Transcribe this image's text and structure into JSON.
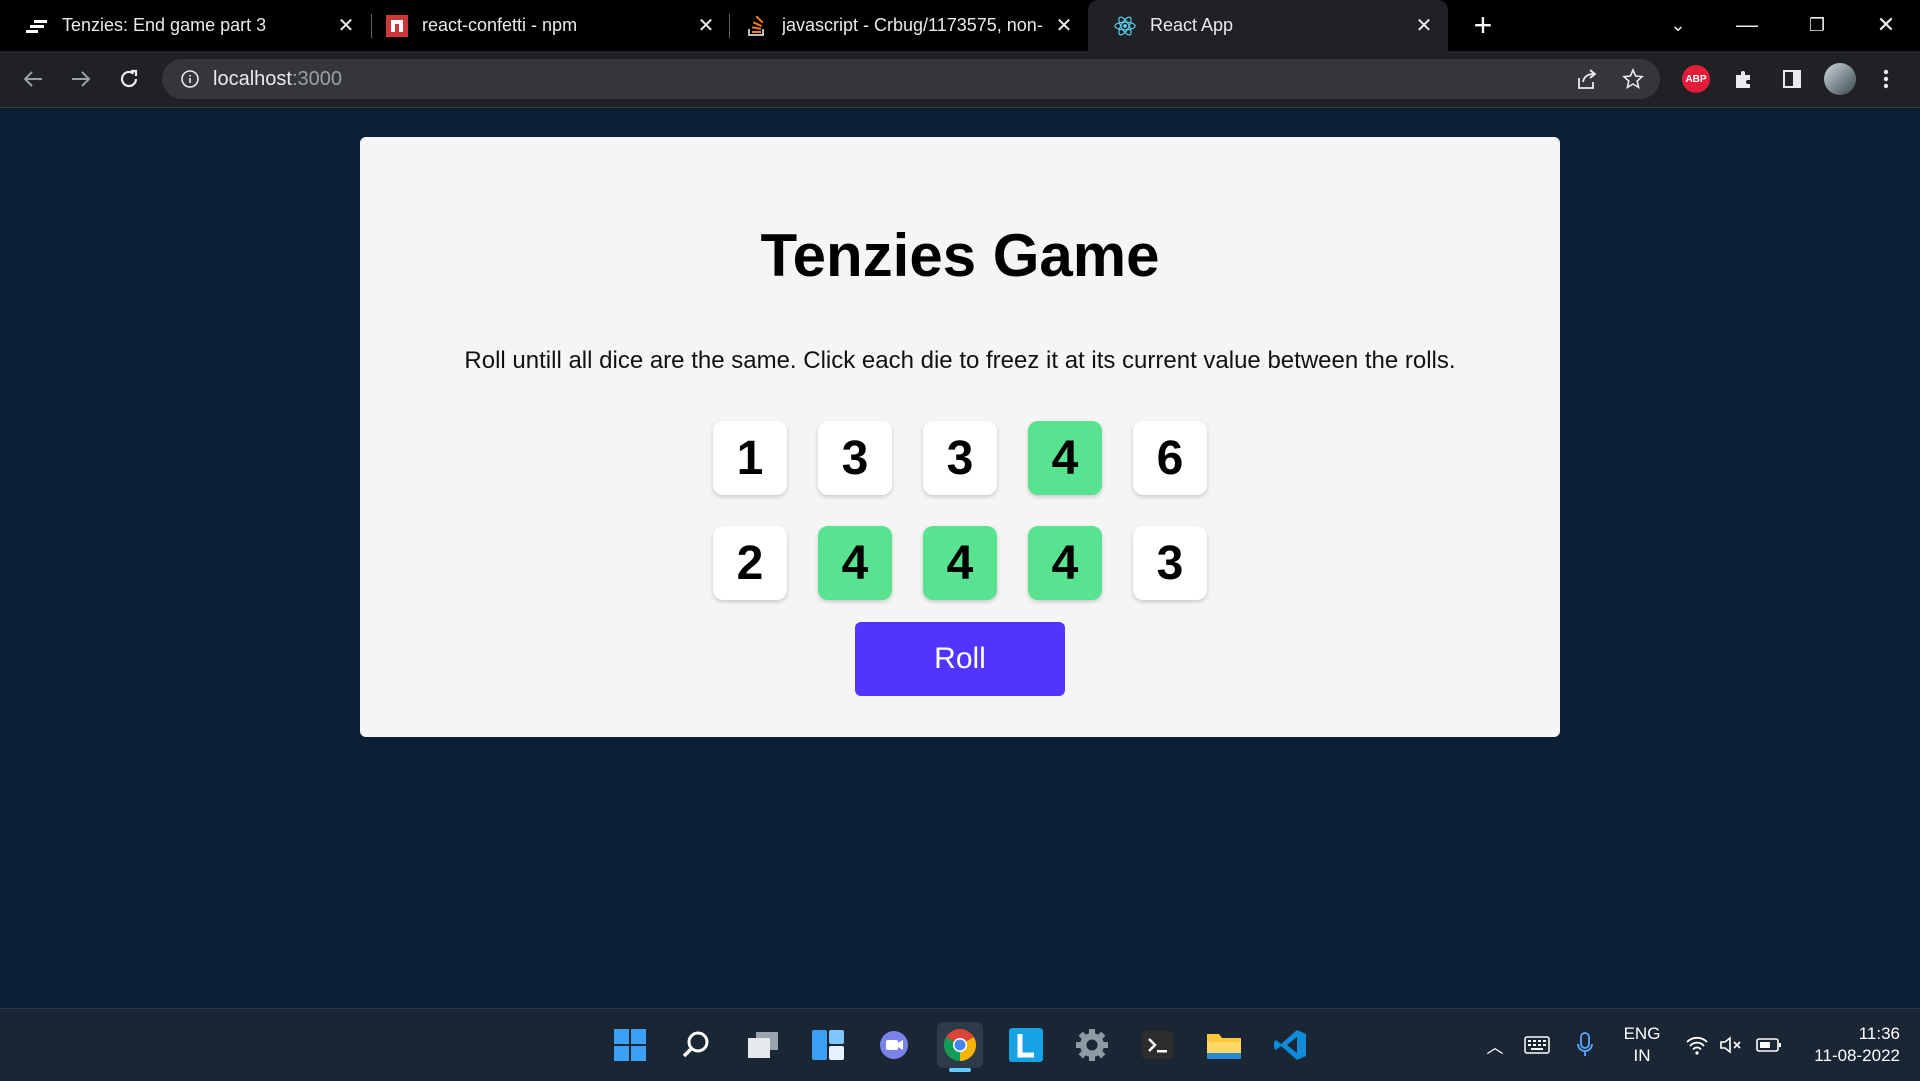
{
  "browser": {
    "tabs": [
      {
        "title": "Tenzies: End game part 3",
        "active": false
      },
      {
        "title": "react-confetti - npm",
        "active": false
      },
      {
        "title": "javascript - Crbug/1173575, non-",
        "active": false
      },
      {
        "title": "React App",
        "active": true
      }
    ],
    "new_tab_label": "+",
    "url_host": "localhost",
    "url_port": ":3000",
    "extension_abp_label": "ABP"
  },
  "page": {
    "title": "Tenzies Game",
    "instructions": "Roll untill all dice are the same. Click each die to freez it at its current value between the rolls.",
    "dice": [
      {
        "value": "1",
        "held": false
      },
      {
        "value": "3",
        "held": false
      },
      {
        "value": "3",
        "held": false
      },
      {
        "value": "4",
        "held": true
      },
      {
        "value": "6",
        "held": false
      },
      {
        "value": "2",
        "held": false
      },
      {
        "value": "4",
        "held": true
      },
      {
        "value": "4",
        "held": true
      },
      {
        "value": "4",
        "held": true
      },
      {
        "value": "3",
        "held": false
      }
    ],
    "roll_label": "Roll",
    "colors": {
      "held": "#59e391",
      "roll_button": "#5035ff",
      "background": "#0b2034"
    }
  },
  "taskbar": {
    "apps": [
      "start-icon",
      "search-icon",
      "task-view-icon",
      "widgets-icon",
      "chat-icon",
      "chrome-icon",
      "l-app-icon",
      "settings-icon",
      "terminal-icon",
      "file-explorer-icon",
      "vscode-icon"
    ],
    "lang_top": "ENG",
    "lang_bottom": "IN",
    "time": "11:36",
    "date": "11-08-2022"
  }
}
